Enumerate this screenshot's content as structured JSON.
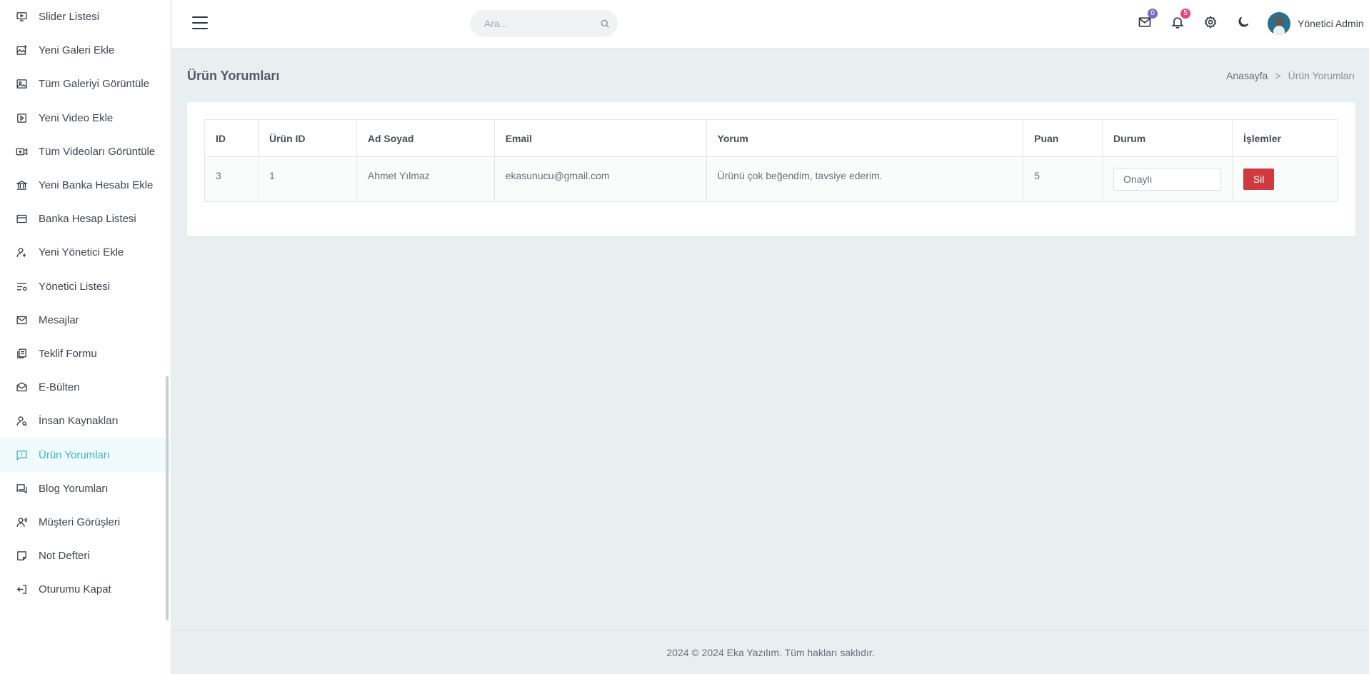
{
  "sidebar": {
    "items": [
      {
        "label": "Slider Listesi",
        "icon": "monitor-icon"
      },
      {
        "label": "Yeni Galeri Ekle",
        "icon": "gallery-add-icon"
      },
      {
        "label": "Tüm Galeriyi Görüntüle",
        "icon": "image-icon"
      },
      {
        "label": "Yeni Video Ekle",
        "icon": "video-play-icon"
      },
      {
        "label": "Tüm Videoları Görüntüle",
        "icon": "video-camera-icon"
      },
      {
        "label": "Yeni Banka Hesabı Ekle",
        "icon": "bank-icon"
      },
      {
        "label": "Banka Hesap Listesi",
        "icon": "credit-card-icon"
      },
      {
        "label": "Yeni Yönetici Ekle",
        "icon": "user-add-icon"
      },
      {
        "label": "Yönetici Listesi",
        "icon": "user-list-icon"
      },
      {
        "label": "Mesajlar",
        "icon": "mail-icon"
      },
      {
        "label": "Teklif Formu",
        "icon": "document-copy-icon"
      },
      {
        "label": "E-Bülten",
        "icon": "newsletter-icon"
      },
      {
        "label": "İnsan Kaynakları",
        "icon": "user-search-icon"
      },
      {
        "label": "Ürün Yorumları",
        "icon": "comment-alert-icon",
        "active": true
      },
      {
        "label": "Blog Yorumları",
        "icon": "comments-icon"
      },
      {
        "label": "Müşteri Görüşleri",
        "icon": "user-voice-icon"
      },
      {
        "label": "Not Defteri",
        "icon": "sticky-note-icon"
      },
      {
        "label": "Oturumu Kapat",
        "icon": "logout-icon"
      }
    ]
  },
  "topbar": {
    "search_placeholder": "Ara...",
    "mail_count": "0",
    "notification_count": "5",
    "user_name": "Yönetici Admin"
  },
  "page": {
    "title": "Ürün Yorumları",
    "breadcrumb": {
      "home": "Anasayfa",
      "separator": ">",
      "current": "Ürün Yorumları"
    }
  },
  "table": {
    "headers": [
      "ID",
      "Ürün ID",
      "Ad Soyad",
      "Email",
      "Yorum",
      "Puan",
      "Durum",
      "İşlemler"
    ],
    "rows": [
      {
        "id": "3",
        "product_id": "1",
        "name": "Ahmet Yılmaz",
        "email": "ekasunucu@gmail.com",
        "comment": "Ürünü çok beğendim, tavsiye ederim.",
        "score": "5",
        "status": "Onaylı",
        "action": "Sil"
      }
    ]
  },
  "footer": {
    "text": "2024 © 2024 Eka Yazılım. Tüm hakları saklıdır."
  },
  "colors": {
    "accent": "#3bb3bd",
    "danger": "#d0393e",
    "background": "#e8eff1"
  }
}
